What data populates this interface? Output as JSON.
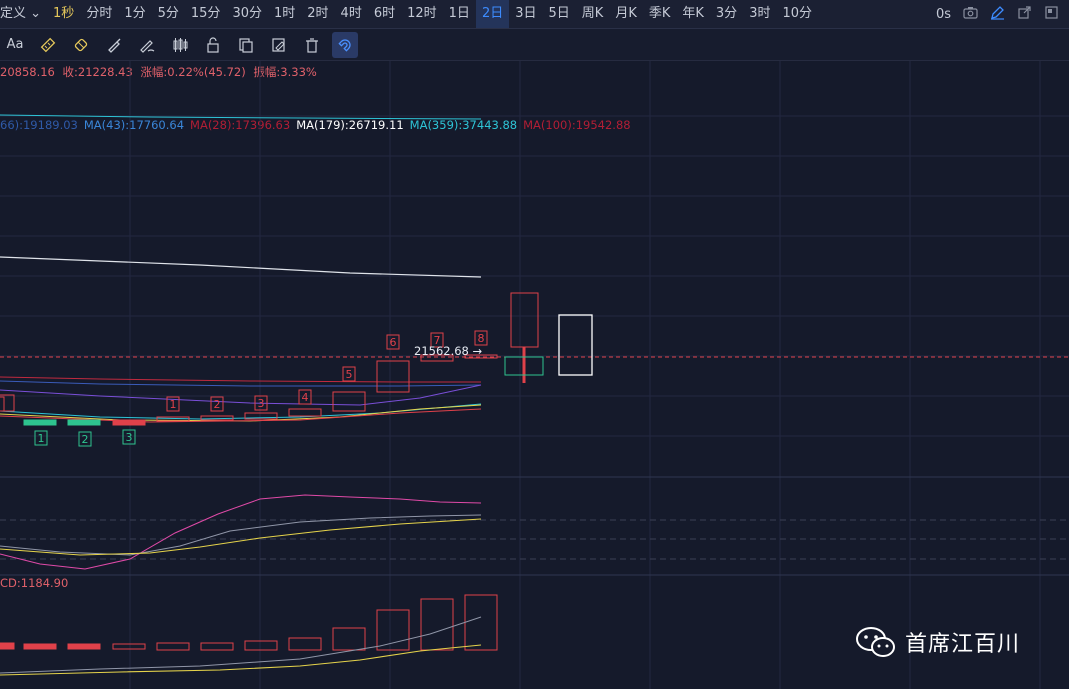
{
  "timeframes": [
    "定义",
    "1秒",
    "分时",
    "1分",
    "5分",
    "15分",
    "30分",
    "1时",
    "2时",
    "4时",
    "6时",
    "12时",
    "1日",
    "2日",
    "3日",
    "5日",
    "周K",
    "月K",
    "季K",
    "年K",
    "3分",
    "3时",
    "10分"
  ],
  "selected_timeframe": "2日",
  "countdown": "0s",
  "toolbar": {
    "text_tool": "Aa"
  },
  "ohlc": {
    "low": "20858.16",
    "close": "收:21228.43",
    "change": "涨幅:0.22%(45.72)",
    "amplitude": "振幅:3.33%"
  },
  "ma_legend": [
    {
      "label": "66):19189.03",
      "color": "#2f5aa8"
    },
    {
      "label": "MA(43):17760.64",
      "color": "#3a86d8"
    },
    {
      "label": "MA(28):17396.63",
      "color": "#b21e35"
    },
    {
      "label": "MA(179):26719.11",
      "color": "#ffffff"
    },
    {
      "label": "MA(359):37443.88",
      "color": "#2ec4d6"
    },
    {
      "label": "MA(100):19542.88",
      "color": "#b21e35"
    }
  ],
  "last_price": "21562.68 →",
  "macd_label": "CD:1184.90",
  "sequence_up": [
    "1",
    "2",
    "3",
    "4",
    "5",
    "6",
    "7",
    "8"
  ],
  "sequence_down": [
    "1",
    "2",
    "3"
  ],
  "watermark": "首席江百川",
  "colors": {
    "up": "#e0414a",
    "down": "#2ec48f",
    "accent": "#3d8cff"
  }
}
